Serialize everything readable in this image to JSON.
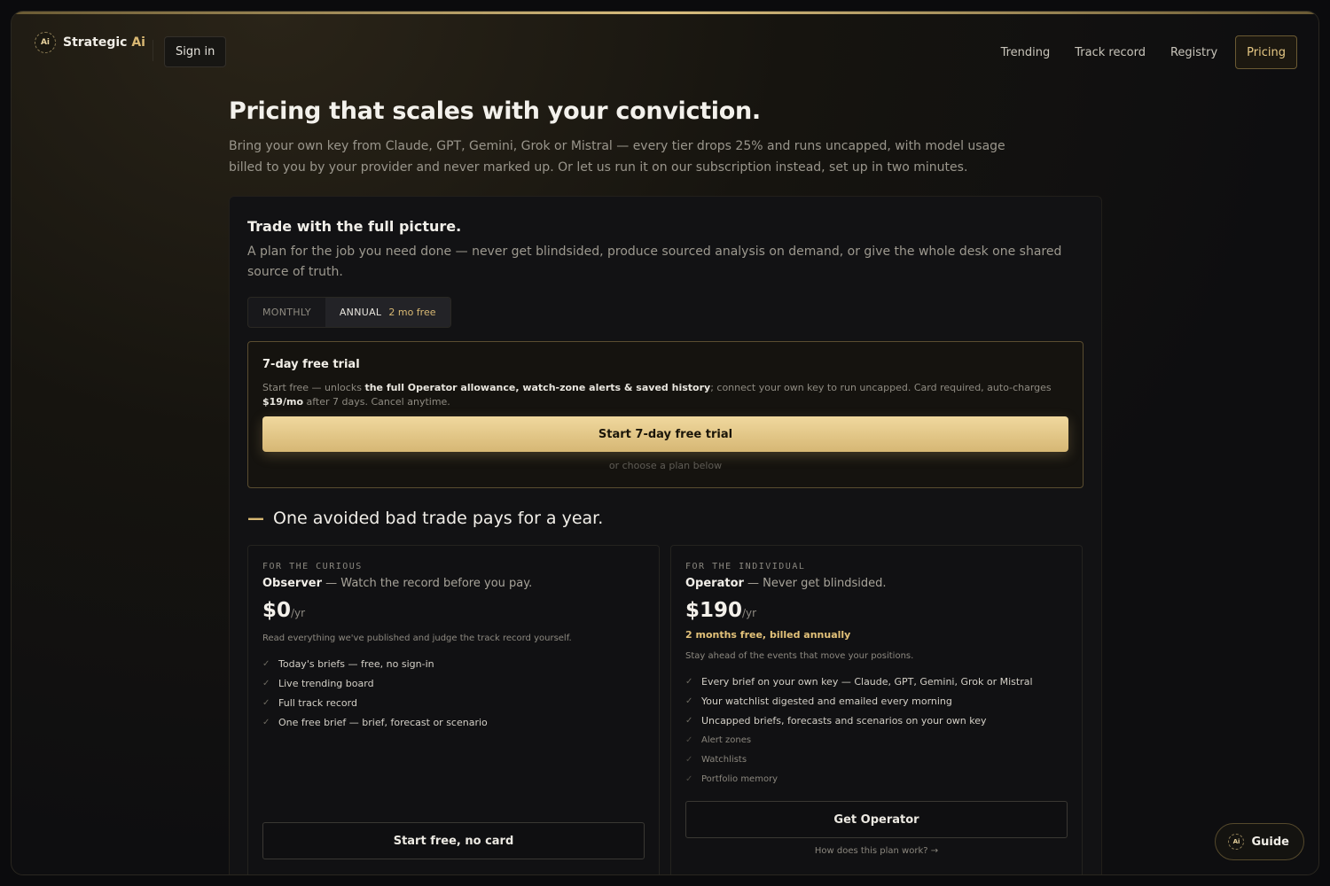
{
  "header": {
    "logo_mark": "Ai",
    "brand_name": "Strategic",
    "brand_suffix": "Ai",
    "sign_in": "Sign in",
    "nav": [
      "Trending",
      "Track record",
      "Registry",
      "Pricing"
    ],
    "active_nav": "Pricing"
  },
  "hero": {
    "title": "Pricing that scales with your conviction.",
    "subtitle": "Bring your own key from Claude, GPT, Gemini, Grok or Mistral — every tier drops 25% and runs uncapped, with model usage billed to you by your provider and never marked up. Or let us run it on our subscription instead, set up in two minutes."
  },
  "panel": {
    "title": "Trade with the full picture.",
    "subtitle": "A plan for the job you need done — never get blindsided, produce sourced analysis on demand, or give the whole desk one shared source of truth.",
    "billing_toggle": {
      "monthly": "MONTHLY",
      "annual": "ANNUAL",
      "annual_badge": "2 mo free",
      "selected": "annual"
    }
  },
  "trial": {
    "title": "7-day free trial",
    "desc_pre": "Start free — unlocks ",
    "desc_bold": "the full Operator allowance, watch-zone alerts & saved history",
    "desc_mid": "; connect your own key to run uncapped. Card required, auto-charges ",
    "desc_price": "$19/mo",
    "desc_post": " after 7 days. Cancel anytime.",
    "button": "Start 7-day free trial",
    "or_text": "or choose a plan below"
  },
  "tagline": {
    "dash": "—",
    "text": "One avoided bad trade pays for a year."
  },
  "plans": [
    {
      "eyebrow": "FOR THE CURIOUS",
      "name": "Observer",
      "tagline": " — Watch the record before you pay.",
      "price": "$0",
      "period": "/yr",
      "free_note": "",
      "description": "Read everything we've published and judge the track record yourself.",
      "features": [
        {
          "text": "Today's briefs — free, no sign-in",
          "dim": false
        },
        {
          "text": "Live trending board",
          "dim": false
        },
        {
          "text": "Full track record",
          "dim": false
        },
        {
          "text": "One free brief — brief, forecast or scenario",
          "dim": false
        }
      ],
      "cta": "Start free, no card",
      "link": ""
    },
    {
      "eyebrow": "FOR THE INDIVIDUAL",
      "name": "Operator",
      "tagline": " — Never get blindsided.",
      "price": "$190",
      "period": "/yr",
      "free_note": "2 months free, billed annually",
      "description": "Stay ahead of the events that move your positions.",
      "features": [
        {
          "text": "Every brief on your own key — Claude, GPT, Gemini, Grok or Mistral",
          "dim": false
        },
        {
          "text": "Your watchlist digested and emailed every morning",
          "dim": false
        },
        {
          "text": "Uncapped briefs, forecasts and scenarios on your own key",
          "dim": false
        },
        {
          "text": "Alert zones",
          "dim": true
        },
        {
          "text": "Watchlists",
          "dim": true
        },
        {
          "text": "Portfolio memory",
          "dim": true
        }
      ],
      "cta": "Get Operator",
      "link": "How does this plan work? →"
    }
  ],
  "guide": {
    "icon": "Ai",
    "label": "Guide"
  },
  "colors": {
    "accent_gold": "#d8b873",
    "background": "#0e0e10",
    "panel": "#121214"
  }
}
